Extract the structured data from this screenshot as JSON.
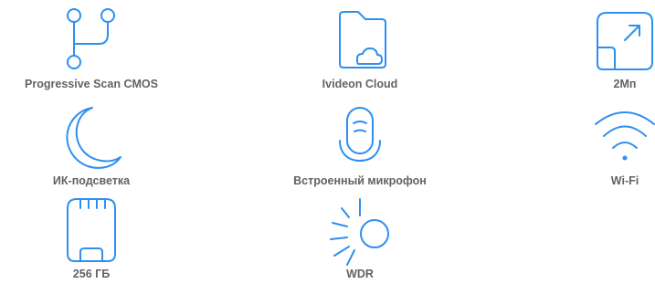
{
  "theme": {
    "icon_color": "#2e8ff0",
    "label_color": "#5f6368"
  },
  "features": [
    {
      "icon": "branch-icon",
      "label": "Progressive Scan CMOS"
    },
    {
      "icon": "cloud-folder-icon",
      "label": "Ivideon Cloud"
    },
    {
      "icon": "expand-arrow-icon",
      "label": "2Мп"
    },
    {
      "icon": "moon-icon",
      "label": "ИК-подсветка"
    },
    {
      "icon": "microphone-icon",
      "label": "Встроенный микрофон"
    },
    {
      "icon": "wifi-icon",
      "label": "Wi-Fi"
    },
    {
      "icon": "sd-card-icon",
      "label": "256 ГБ"
    },
    {
      "icon": "sun-icon",
      "label": "WDR"
    }
  ]
}
